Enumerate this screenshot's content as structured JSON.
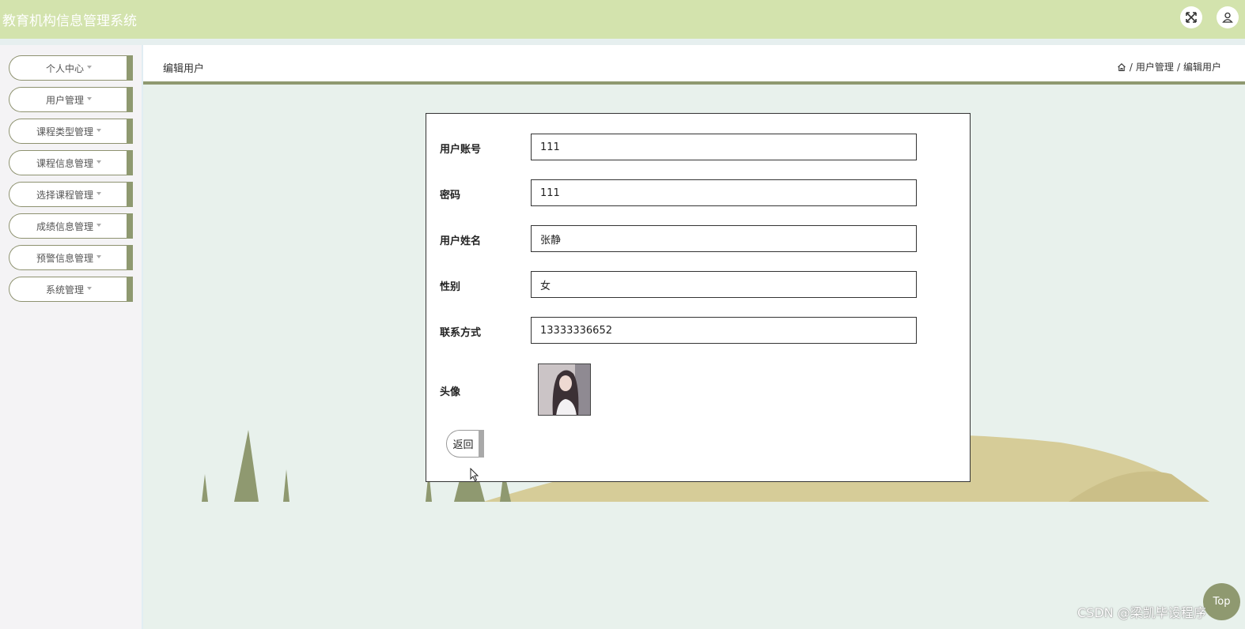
{
  "app": {
    "title": "教育机构信息管理系统"
  },
  "header_actions": {
    "fullscreen_icon": "expand-arrows-icon",
    "user_icon": "user-icon"
  },
  "sidebar": {
    "items": [
      {
        "label": "个人中心"
      },
      {
        "label": "用户管理"
      },
      {
        "label": "课程类型管理"
      },
      {
        "label": "课程信息管理"
      },
      {
        "label": "选择课程管理"
      },
      {
        "label": "成绩信息管理"
      },
      {
        "label": "预警信息管理"
      },
      {
        "label": "系统管理"
      }
    ]
  },
  "page": {
    "title": "编辑用户",
    "breadcrumb": {
      "home_icon": "home-icon",
      "separator": "/",
      "items": [
        "用户管理",
        "编辑用户"
      ]
    }
  },
  "form": {
    "fields": [
      {
        "label": "用户账号",
        "value": "111"
      },
      {
        "label": "密码",
        "value": "111"
      },
      {
        "label": "用户姓名",
        "value": "张静"
      },
      {
        "label": "性别",
        "value": "女"
      },
      {
        "label": "联系方式",
        "value": "13333336652"
      }
    ],
    "avatar_label": "头像",
    "back_label": "返回"
  },
  "fab": {
    "label": "Top"
  },
  "watermark": {
    "text": "CSDN @梁凯毕设程序"
  },
  "colors": {
    "topbar": "#d3e3ad",
    "accent": "#8f9970",
    "content_bg": "#e8f1ec",
    "hill": "#d6cc98"
  }
}
